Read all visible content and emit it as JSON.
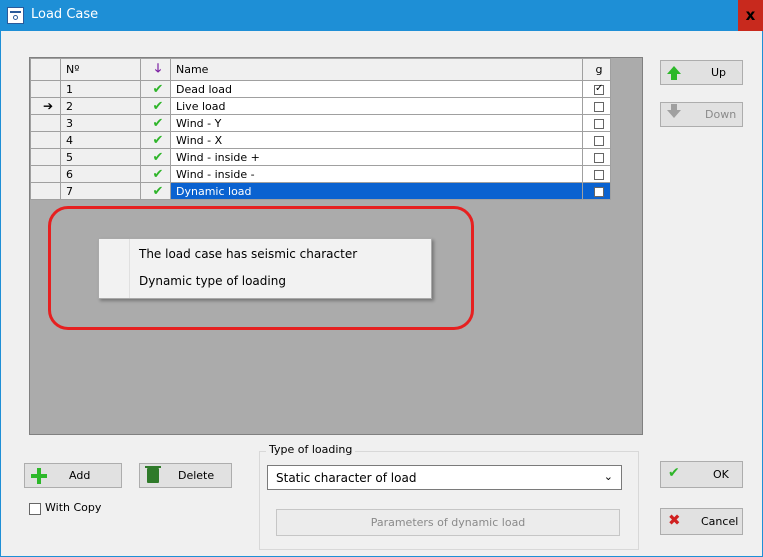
{
  "window": {
    "title": "Load Case",
    "close_label": "x"
  },
  "grid": {
    "headers": {
      "num": "Nº",
      "name": "Name",
      "g": "g"
    },
    "rows": [
      {
        "num": "1",
        "name": "Dead load",
        "g_checked": true,
        "current": false,
        "selected": false
      },
      {
        "num": "2",
        "name": "Live load",
        "g_checked": false,
        "current": true,
        "selected": false
      },
      {
        "num": "3",
        "name": "Wind - Y",
        "g_checked": false,
        "current": false,
        "selected": false
      },
      {
        "num": "4",
        "name": "Wind - X",
        "g_checked": false,
        "current": false,
        "selected": false
      },
      {
        "num": "5",
        "name": "Wind - inside +",
        "g_checked": false,
        "current": false,
        "selected": false
      },
      {
        "num": "6",
        "name": "Wind - inside -",
        "g_checked": false,
        "current": false,
        "selected": false
      },
      {
        "num": "7",
        "name": "Dynamic load",
        "g_checked": false,
        "current": false,
        "selected": true
      }
    ]
  },
  "context_menu": {
    "items": [
      "The load case has seismic character",
      "Dynamic type of loading"
    ]
  },
  "buttons": {
    "up": "Up",
    "down": "Down",
    "add": "Add",
    "delete": "Delete",
    "ok": "OK",
    "cancel": "Cancel"
  },
  "with_copy": {
    "label": "With Copy",
    "checked": false
  },
  "type_of_loading": {
    "title": "Type of loading",
    "selected": "Static character of load",
    "params_label": "Parameters of dynamic load"
  },
  "colors": {
    "title_bar": "#1e8fd6",
    "selection": "#0a62d0",
    "highlight_ring": "#e62020"
  }
}
